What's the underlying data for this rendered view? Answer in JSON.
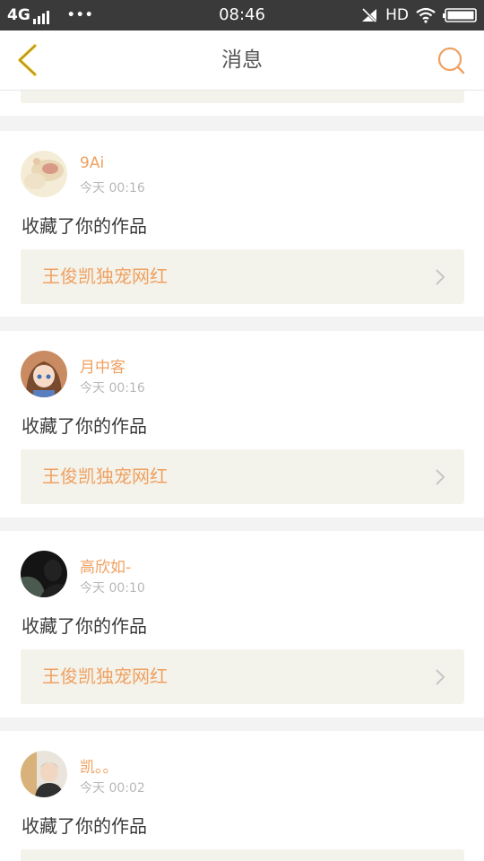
{
  "status_bar": {
    "network": "4G",
    "dots": "•••",
    "time": "08:46",
    "hd": "HD"
  },
  "header": {
    "title": "消息"
  },
  "colors": {
    "accent": "#f0a060",
    "back_icon": "#e8c020"
  },
  "messages": [
    {
      "user": "9Ai",
      "time": "今天 00:16",
      "action": "收藏了你的作品",
      "work": "王俊凯独宠网红"
    },
    {
      "user": "月中客",
      "time": "今天 00:16",
      "action": "收藏了你的作品",
      "work": "王俊凯独宠网红"
    },
    {
      "user": "高欣如-",
      "time": "今天 00:10",
      "action": "收藏了你的作品",
      "work": "王俊凯独宠网红"
    },
    {
      "user": "凯。。",
      "time": "今天 00:02",
      "action": "收藏了你的作品"
    }
  ]
}
